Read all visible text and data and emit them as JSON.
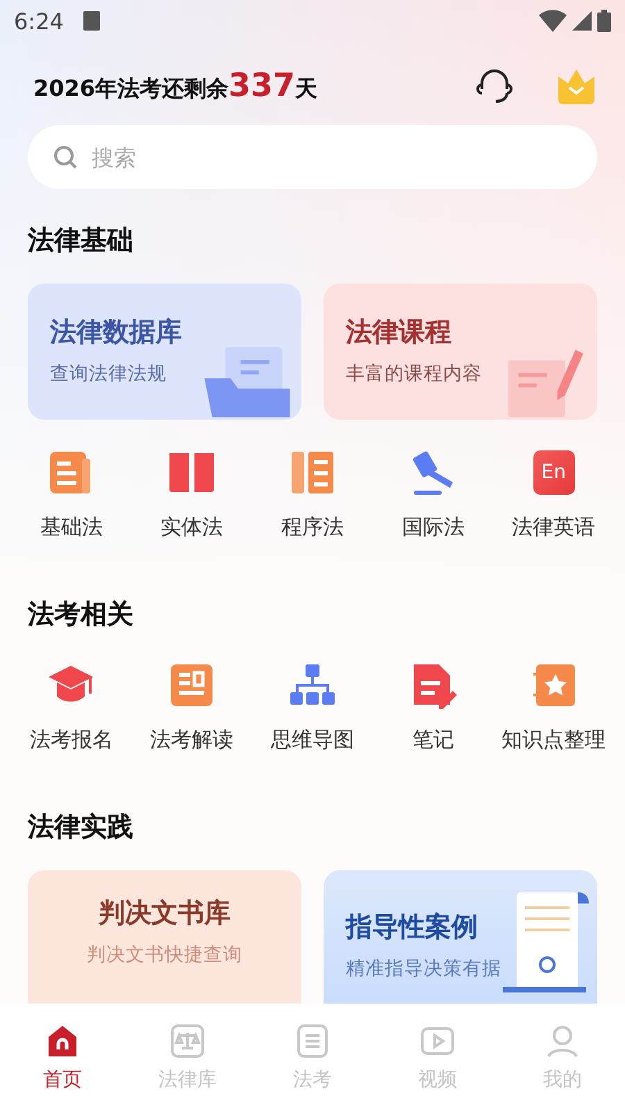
{
  "status_bar": {
    "time": "6:24"
  },
  "header": {
    "countdown_prefix": "2026年法考还剩余",
    "countdown_days": "337",
    "countdown_suffix": "天"
  },
  "search": {
    "placeholder": "搜索"
  },
  "sections": [
    {
      "title": "法律基础",
      "cards": [
        {
          "title": "法律数据库",
          "subtitle": "查询法律法规",
          "kind": "database"
        },
        {
          "title": "法律课程",
          "subtitle": "丰富的课程内容",
          "kind": "course"
        }
      ],
      "items": [
        {
          "label": "基础法",
          "kind": "doc"
        },
        {
          "label": "实体法",
          "kind": "book"
        },
        {
          "label": "程序法",
          "kind": "list"
        },
        {
          "label": "国际法",
          "kind": "gavel"
        },
        {
          "label": "法律英语",
          "kind": "en",
          "badge": "En"
        }
      ]
    },
    {
      "title": "法考相关",
      "items": [
        {
          "label": "法考报名",
          "kind": "cap"
        },
        {
          "label": "法考解读",
          "kind": "read"
        },
        {
          "label": "思维导图",
          "kind": "tree"
        },
        {
          "label": "笔记",
          "kind": "note"
        },
        {
          "label": "知识点整理",
          "kind": "star"
        }
      ]
    },
    {
      "title": "法律实践",
      "cards": [
        {
          "title": "判决文书库",
          "subtitle": "判决文书快捷查询",
          "kind": "judgment"
        },
        {
          "title": "指导性案例",
          "subtitle": "精准指导决策有据",
          "kind": "case"
        }
      ]
    }
  ],
  "tab_bar": [
    {
      "label": "首页",
      "kind": "home",
      "selected": true
    },
    {
      "label": "法律库",
      "kind": "scale",
      "selected": false
    },
    {
      "label": "法考",
      "kind": "exam",
      "selected": false
    },
    {
      "label": "视频",
      "kind": "video",
      "selected": false
    },
    {
      "label": "我的",
      "kind": "me",
      "selected": false
    }
  ]
}
